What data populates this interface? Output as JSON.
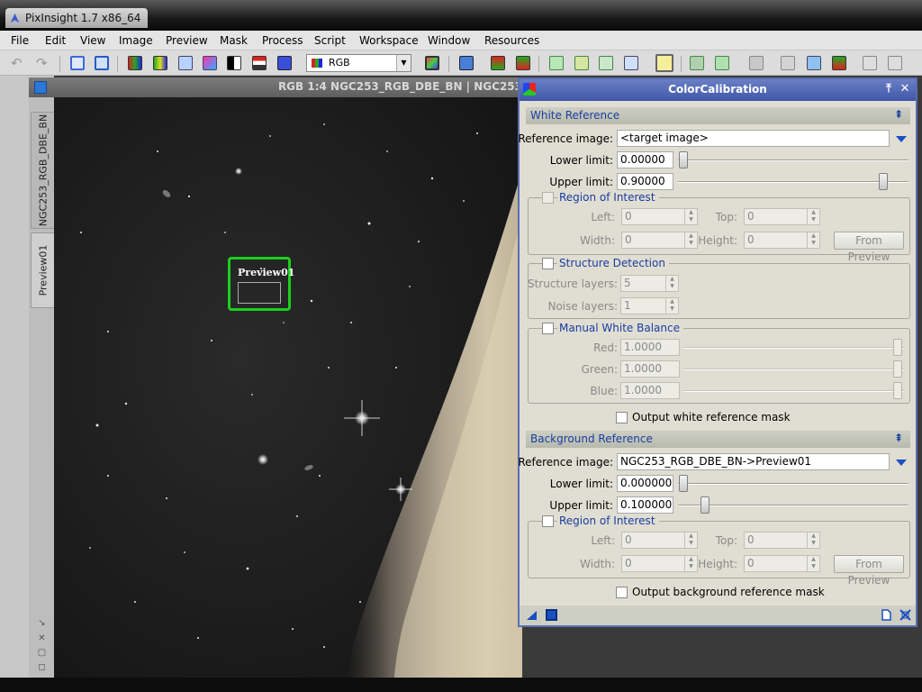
{
  "app": {
    "title": "PixInsight 1.7 x86_64"
  },
  "menu": [
    "File",
    "Edit",
    "View",
    "Image",
    "Preview",
    "Mask",
    "Process",
    "Script",
    "Workspace",
    "Window",
    "Resources"
  ],
  "toolbar": {
    "color_mode": "RGB"
  },
  "side_tabs": {
    "main_view": "NGC253_RGB_DBE_BN",
    "preview": "Preview01"
  },
  "image_window": {
    "title": "RGB 1:4 NGC253_RGB_DBE_BN | NGC253",
    "preview_label": "Preview01"
  },
  "dialog": {
    "title": "ColorCalibration",
    "white_reference": {
      "header": "White Reference",
      "reference_image_label": "Reference image:",
      "reference_image": "<target image>",
      "lower_limit_label": "Lower limit:",
      "lower_limit": "0.00000",
      "lower_limit_value": 0.0,
      "upper_limit_label": "Upper limit:",
      "upper_limit": "0.90000",
      "upper_limit_value": 0.9,
      "roi": {
        "title": "Region of Interest",
        "left_label": "Left:",
        "left": "0",
        "top_label": "Top:",
        "top": "0",
        "width_label": "Width:",
        "width": "0",
        "height_label": "Height:",
        "height": "0",
        "from_preview": "From Preview"
      },
      "structure_detection": {
        "title": "Structure Detection",
        "structure_layers_label": "Structure layers:",
        "structure_layers": "5",
        "noise_layers_label": "Noise layers:",
        "noise_layers": "1"
      },
      "manual_white_balance": {
        "title": "Manual White Balance",
        "red_label": "Red:",
        "red": "1.0000",
        "green_label": "Green:",
        "green": "1.0000",
        "blue_label": "Blue:",
        "blue": "1.0000"
      },
      "output_mask": "Output white reference mask"
    },
    "background_reference": {
      "header": "Background Reference",
      "reference_image_label": "Reference image:",
      "reference_image": "NGC253_RGB_DBE_BN->Preview01",
      "lower_limit_label": "Lower limit:",
      "lower_limit": "0.000000",
      "lower_limit_value": 0.0,
      "upper_limit_label": "Upper limit:",
      "upper_limit": "0.100000",
      "upper_limit_value": 0.1,
      "roi": {
        "title": "Region of Interest",
        "left_label": "Left:",
        "left": "0",
        "top_label": "Top:",
        "top": "0",
        "width_label": "Width:",
        "width": "0",
        "height_label": "Height:",
        "height": "0",
        "from_preview": "From Preview"
      },
      "output_mask": "Output background reference mask"
    }
  },
  "colors": {
    "dialog_title": "#4a5fb0",
    "section_text": "#1a3ea0",
    "preview_rect": "#1ccf1c"
  }
}
